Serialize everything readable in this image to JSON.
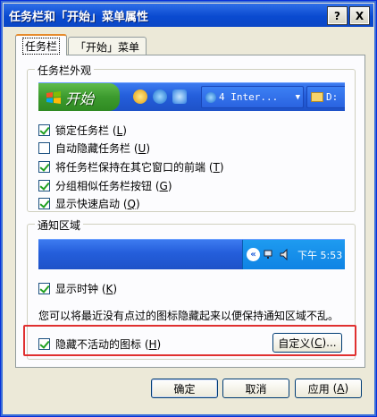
{
  "window": {
    "title": "任务栏和「开始」菜单属性",
    "help_glyph": "?",
    "close_glyph": "X"
  },
  "tabs": [
    {
      "label": "任务栏",
      "active": true
    },
    {
      "label": "「开始」菜单",
      "active": false
    }
  ],
  "appearance": {
    "group_label": "任务栏外观",
    "preview": {
      "start_label": "开始",
      "task_item": "Inter...",
      "task_item_number": "4",
      "task_item2": "D:"
    },
    "options": [
      {
        "label": "锁定任务栏",
        "key": "L",
        "checked": true
      },
      {
        "label": "自动隐藏任务栏",
        "key": "U",
        "checked": false
      },
      {
        "label": "将任务栏保持在其它窗口的前端",
        "key": "T",
        "checked": true
      },
      {
        "label": "分组相似任务栏按钮",
        "key": "G",
        "checked": true
      },
      {
        "label": "显示快速启动",
        "key": "Q",
        "checked": true
      }
    ]
  },
  "notify": {
    "group_label": "通知区域",
    "preview": {
      "chevron": "«",
      "clock": "下午 5:53"
    },
    "show_clock": {
      "label": "显示时钟",
      "key": "K",
      "checked": true
    },
    "hint": "您可以将最近没有点过的图标隐藏起来以便保持通知区域不乱。",
    "hide_inactive": {
      "label": "隐藏不活动的图标",
      "key": "H",
      "checked": true
    },
    "customize": {
      "label": "自定义",
      "key": "C",
      "suffix": "..."
    }
  },
  "buttons": {
    "ok": "确定",
    "cancel": "取消",
    "apply": "应用",
    "apply_key": "A"
  },
  "colors": {
    "taskbar_blue": "#245edb",
    "start_green": "#3c9a2e",
    "highlight": "#e03030",
    "titlebar": "#0a4ad0"
  }
}
